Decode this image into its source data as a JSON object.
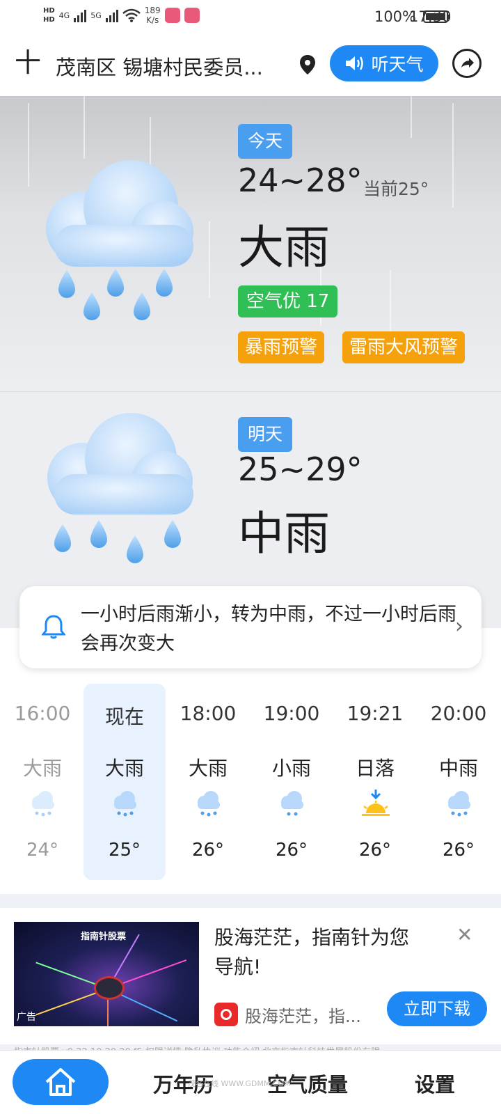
{
  "status_bar": {
    "hd1": "HD",
    "hd2": "HD",
    "net1": "4G",
    "net2": "5G",
    "speed_value": "189",
    "speed_unit": "K/s",
    "battery": "100%",
    "time": "17:30"
  },
  "header": {
    "add_label": "十",
    "location": "茂南区 锡塘村民委员...",
    "listen_label": "听天气"
  },
  "today": {
    "tag": "今天",
    "temp_range": "24~28°",
    "current": "当前25°",
    "weather": "大雨",
    "air_quality": "空气优 17",
    "warnings": [
      "暴雨预警",
      "雷雨大风预警"
    ]
  },
  "tomorrow": {
    "tag": "明天",
    "temp_range": "25~29°",
    "weather": "中雨"
  },
  "notice": {
    "text": "一小时后雨渐小，转为中雨，不过一小时后雨会再次变大"
  },
  "hourly": [
    {
      "time": "16:00",
      "weather": "大雨",
      "temp": "24°",
      "icon": "rain-cloud-icon"
    },
    {
      "time": "现在",
      "weather": "大雨",
      "temp": "25°",
      "icon": "rain-cloud-icon"
    },
    {
      "time": "18:00",
      "weather": "大雨",
      "temp": "26°",
      "icon": "rain-cloud-icon"
    },
    {
      "time": "19:00",
      "weather": "小雨",
      "temp": "26°",
      "icon": "rain-cloud-icon"
    },
    {
      "time": "19:21",
      "weather": "日落",
      "temp": "26°",
      "icon": "sunset-icon"
    },
    {
      "time": "20:00",
      "weather": "中雨",
      "temp": "26°",
      "icon": "rain-cloud-icon"
    }
  ],
  "ad": {
    "image_title": "指南针股票",
    "image_tag": "广告",
    "title": "股海茫茫，指南针为您导航!",
    "brand": "股海茫茫，指...",
    "button": "立即下载",
    "footer": "指南针股票 v9.22.10.20.20.f5 权限详情 隐私协议 功能介绍 北京指南针科技发展股份有限"
  },
  "bottom_nav": {
    "items": [
      "万年历",
      "空气质量",
      "设置"
    ]
  },
  "watermark": "茂名在线 WWW.GDMM.COM",
  "colors": {
    "accent": "#1e88f5",
    "air_good": "#2fbf55",
    "warning": "#f5a10c",
    "tag_blue": "#4a9ef0"
  }
}
